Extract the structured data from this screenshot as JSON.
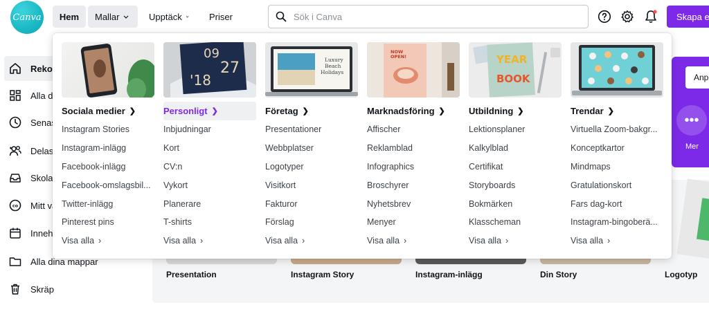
{
  "brand": {
    "logo_text": "Canva",
    "accent": "#7d2ae8",
    "logo_color": "#1ab8c4"
  },
  "nav": {
    "home": "Hem",
    "templates": "Mallar",
    "discover": "Upptäck",
    "pricing": "Priser"
  },
  "search": {
    "placeholder": "Sök i Canva"
  },
  "toolbar": {
    "help_icon": "question-circle-icon",
    "settings_icon": "gear-icon",
    "notifications_icon": "bell-icon",
    "create_label": "Skapa en"
  },
  "sidebar": {
    "items": [
      {
        "label": "Rekom",
        "icon": "home-icon",
        "active": true
      },
      {
        "label": "Alla di",
        "icon": "grid-icon"
      },
      {
        "label": "Senast",
        "icon": "clock-icon"
      },
      {
        "label": "Delas",
        "icon": "people-icon"
      },
      {
        "label": "Skolar",
        "icon": "inbox-icon"
      },
      {
        "label": "Mitt va",
        "icon": "brand-kit-icon"
      },
      {
        "label": "Inneh",
        "icon": "calendar-icon"
      },
      {
        "label": "Alla dina mappar",
        "icon": "folder-icon"
      },
      {
        "label": "Skräp",
        "icon": "trash-icon"
      }
    ]
  },
  "hero": {
    "button_label": "Anp",
    "more_label": "Mer"
  },
  "templates_row": [
    "Presentation",
    "Instagram Story",
    "Instagram-inlägg",
    "Din Story",
    "Logotyp"
  ],
  "dropdown": {
    "more_label": "Visa alla",
    "columns": [
      {
        "heading": "Sociala medier",
        "items": [
          "Instagram Stories",
          "Instagram-inlägg",
          "Facebook-inlägg",
          "Facebook-omslagsbil...",
          "Twitter-inlägg",
          "Pinterest pins"
        ]
      },
      {
        "heading": "Personligt",
        "highlighted": true,
        "image_text_1": "09",
        "image_text_2": "27",
        "image_text_3": "'18",
        "items": [
          "Inbjudningar",
          "Kort",
          "CV:n",
          "Vykort",
          "Planerare",
          "T-shirts"
        ]
      },
      {
        "heading": "Företag",
        "image_text": "Luxury Beach Holidays",
        "items": [
          "Presentationer",
          "Webbplatser",
          "Logotyper",
          "Visitkort",
          "Fakturor",
          "Förslag"
        ]
      },
      {
        "heading": "Marknadsföring",
        "image_text": "NOW OPEN!",
        "items": [
          "Affischer",
          "Reklamblad",
          "Infographics",
          "Broschyrer",
          "Nyhetsbrev",
          "Menyer"
        ]
      },
      {
        "heading": "Utbildning",
        "image_text_1": "YEAR",
        "image_text_2": "BOOK",
        "items": [
          "Lektionsplaner",
          "Kalkylblad",
          "Certifikat",
          "Storyboards",
          "Bokmärken",
          "Klasscheman"
        ]
      },
      {
        "heading": "Trendar",
        "items": [
          "Virtuella Zoom-bakgr...",
          "Konceptkartor",
          "Mindmaps",
          "Gratulationskort",
          "Fars dag-kort",
          "Instagram-bingoberä..."
        ]
      }
    ]
  }
}
